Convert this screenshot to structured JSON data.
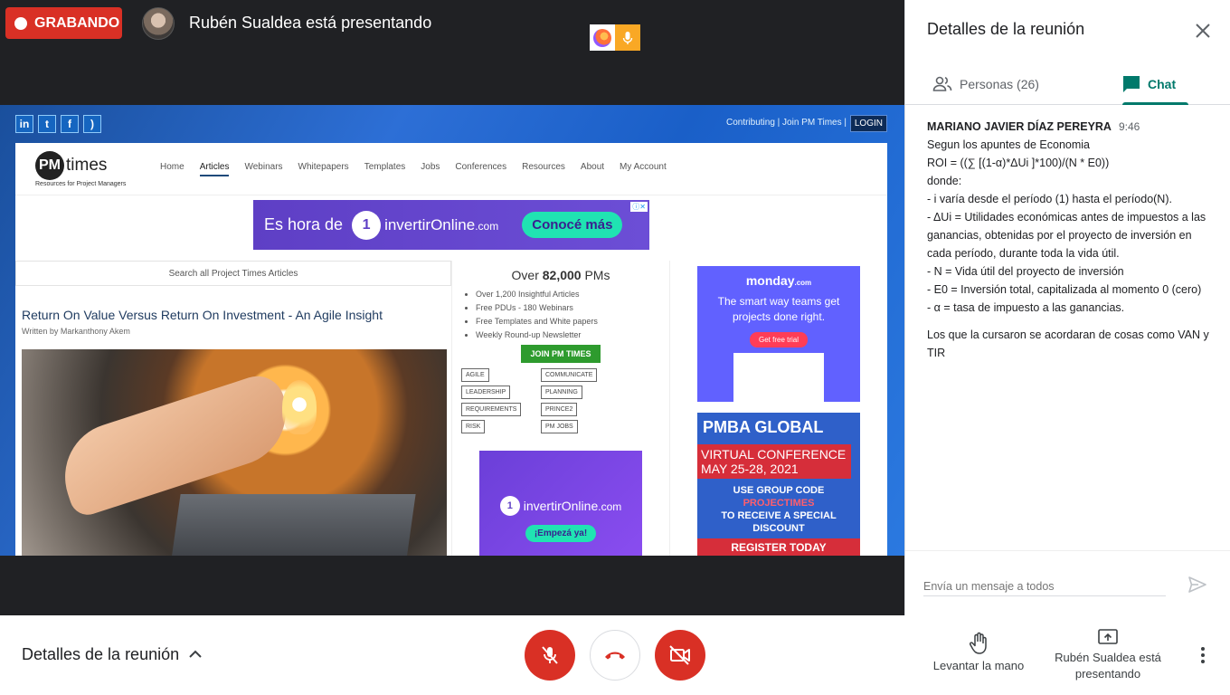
{
  "recording": {
    "label": "GRABANDO"
  },
  "presenter": {
    "text": "Rubén Sualdea está presentando"
  },
  "shared_page": {
    "social_icons": [
      "in",
      "t",
      "f",
      "rss"
    ],
    "top_links": "Contributing | Join PM Times |",
    "login": "LOGIN",
    "logo_pm": "PM",
    "logo_times": "times",
    "logo_tagline": "Resources for Project Managers",
    "nav": [
      "Home",
      "Articles",
      "Webinars",
      "Whitepapers",
      "Templates",
      "Jobs",
      "Conferences",
      "Resources",
      "About",
      "My Account"
    ],
    "ad_banner": {
      "lead": "Es hora de",
      "brand": "invertirOnline",
      "brand_suffix": ".com",
      "cta": "Conocé más"
    },
    "search_placeholder": "Search all Project Times Articles",
    "article_title": "Return On Value Versus Return On Investment - An Agile Insight",
    "article_byline": "Written by Markanthony Akem",
    "promo": {
      "heading_pre": "Over ",
      "heading_bold": "82,000",
      "heading_post": " PMs",
      "features": [
        "Over 1,200 Insightful Articles",
        "Free PDUs - 180 Webinars",
        "Free Templates and White papers",
        "Weekly Round-up Newsletter"
      ],
      "join": "JOIN PM TIMES",
      "tags": [
        "AGILE",
        "COMMUNICATE",
        "LEADERSHIP",
        "PLANNING",
        "REQUIREMENTS",
        "PRINCE2",
        "RISK",
        "PM JOBS"
      ]
    },
    "ad_small": {
      "brand": "invertirOnline",
      "brand_suffix": ".com",
      "cta": "¡Empezá ya!"
    },
    "ad_monday": {
      "logo": "monday",
      "logo_suffix": ".com",
      "text": "The smart way teams get projects done right.",
      "cta": "Get free trial"
    },
    "ad_pmba": {
      "logo": "PMBA GLOBAL",
      "headline": "VIRTUAL CONFERENCE MAY 25-28, 2021",
      "code_line1": "USE GROUP CODE",
      "code": "PROJECTIMES",
      "code_line2": "TO RECEIVE A SPECIAL DISCOUNT",
      "register": "REGISTER TODAY"
    }
  },
  "panel": {
    "title": "Detalles de la reunión",
    "tab_people": "Personas (26)",
    "tab_chat": "Chat",
    "message": {
      "sender": "MARIANO JAVIER DÍAZ PEREYRA",
      "time": "9:46",
      "lines": [
        "Segun los apuntes de Economia",
        "ROI = ((∑ [(1-α)*ΔUi ]*100)/(N * E0))",
        "donde:",
        "- i varía desde el período (1) hasta el período(N).",
        "- ΔUi = Utilidades económicas antes de impuestos a las ganancias, obtenidas por el proyecto de inversión en cada período, durante toda la vida útil.",
        "- N = Vida útil del proyecto de inversión",
        "- E0 = Inversión total, capitalizada al momento 0 (cero)",
        "- α = tasa de impuesto a las ganancias."
      ],
      "followup": "Los que la cursaron se acordaran de cosas como VAN y TIR"
    },
    "composer_placeholder": "Envía un mensaje a todos"
  },
  "bottom": {
    "details": "Detalles de la reunión",
    "raise_hand": "Levantar la mano",
    "presenting": "Rubén Sualdea está presentando"
  },
  "colors": {
    "record_red": "#d93025",
    "chat_accent": "#00796b",
    "panel_bg": "#ffffff",
    "stage_bg": "#202124"
  }
}
